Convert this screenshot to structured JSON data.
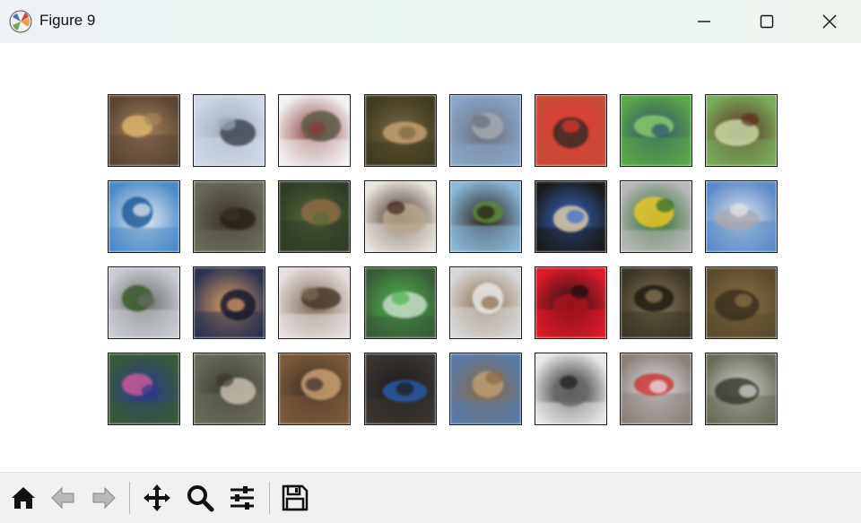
{
  "window": {
    "title": "Figure 9"
  },
  "title_bar_buttons": [
    {
      "name": "minimize",
      "icon": "minimize-icon"
    },
    {
      "name": "maximize",
      "icon": "maximize-icon"
    },
    {
      "name": "close",
      "icon": "close-icon"
    }
  ],
  "figure": {
    "rows": 4,
    "columns": 8,
    "images": [
      {
        "subject": "frog",
        "colors": [
          "#5a4636",
          "#a8845a",
          "#d9b46a"
        ]
      },
      {
        "subject": "truck",
        "colors": [
          "#cfd8e6",
          "#9aa7b8",
          "#3f4650"
        ]
      },
      {
        "subject": "truck",
        "colors": [
          "#f2f2f2",
          "#8a3a3a",
          "#5a5a4a"
        ]
      },
      {
        "subject": "deer",
        "colors": [
          "#3f3a22",
          "#7a6a42",
          "#c2a070"
        ]
      },
      {
        "subject": "automobile",
        "colors": [
          "#8aa6c8",
          "#6a6e78",
          "#a5a8b0"
        ]
      },
      {
        "subject": "automobile",
        "colors": [
          "#c84a3a",
          "#e03a2a",
          "#3a2a24"
        ]
      },
      {
        "subject": "bird",
        "colors": [
          "#5aa64a",
          "#2c4a6a",
          "#8ac86a"
        ]
      },
      {
        "subject": "horse",
        "colors": [
          "#7aaa5a",
          "#5a2e1e",
          "#c8d8a6"
        ]
      },
      {
        "subject": "ship",
        "colors": [
          "#4a8ac8",
          "#e8eef2",
          "#1e5a9a"
        ]
      },
      {
        "subject": "cat",
        "colors": [
          "#6a6a5a",
          "#3a3226",
          "#2a2018"
        ]
      },
      {
        "subject": "deer",
        "colors": [
          "#2e3a26",
          "#5a6a3a",
          "#8a6a42"
        ]
      },
      {
        "subject": "horse",
        "colors": [
          "#e8e4de",
          "#3a2418",
          "#b8a890"
        ]
      },
      {
        "subject": "horse",
        "colors": [
          "#8ab8d8",
          "#2a1a14",
          "#5a8a3a"
        ]
      },
      {
        "subject": "bird",
        "colors": [
          "#1a1a1a",
          "#3a6ac8",
          "#d8c8a6"
        ]
      },
      {
        "subject": "truck",
        "colors": [
          "#b8b8b8",
          "#2a6a2a",
          "#e8c82a"
        ]
      },
      {
        "subject": "truck",
        "colors": [
          "#5a8ac8",
          "#e8e8ec",
          "#a8a8b0"
        ]
      },
      {
        "subject": "automobile",
        "colors": [
          "#c8ccd4",
          "#6a6a64",
          "#3a5a2a"
        ]
      },
      {
        "subject": "cat",
        "colors": [
          "#2a3250",
          "#e0a068",
          "#14182a"
        ]
      },
      {
        "subject": "bird",
        "colors": [
          "#e8dede",
          "#7a6a56",
          "#4a3a2c"
        ]
      },
      {
        "subject": "frog",
        "colors": [
          "#3a5a3a",
          "#4ab84a",
          "#c8d8c8"
        ]
      },
      {
        "subject": "deer",
        "colors": [
          "#d8d8d8",
          "#8a6a4a",
          "#e8e8e8"
        ]
      },
      {
        "subject": "frog",
        "colors": [
          "#e01a2a",
          "#1a1014",
          "#a8141e"
        ]
      },
      {
        "subject": "frog",
        "colors": [
          "#3a3426",
          "#8a7a5a",
          "#1e1a12"
        ]
      },
      {
        "subject": "frog",
        "colors": [
          "#5a4a2e",
          "#8a7446",
          "#3a2e1e"
        ]
      },
      {
        "subject": "bird",
        "colors": [
          "#3a5a3a",
          "#2a3a8a",
          "#c85a9a"
        ]
      },
      {
        "subject": "frog",
        "colors": [
          "#6a6a5a",
          "#3a3a30",
          "#c8c0b0"
        ]
      },
      {
        "subject": "cat",
        "colors": [
          "#7a5a3a",
          "#3a2e26",
          "#c8a070"
        ]
      },
      {
        "subject": "dog",
        "colors": [
          "#3a3430",
          "#1a1a1a",
          "#2a5aa6"
        ]
      },
      {
        "subject": "deer",
        "colors": [
          "#5a7aa6",
          "#8a6a42",
          "#b8a070"
        ]
      },
      {
        "subject": "airplane",
        "colors": [
          "#e8e8e8",
          "#1a1a1a",
          "#6a6a6a"
        ]
      },
      {
        "subject": "airplane",
        "colors": [
          "#8a8078",
          "#e8e8f0",
          "#c83a3a"
        ]
      },
      {
        "subject": "truck",
        "colors": [
          "#6a6a58",
          "#d8d8d8",
          "#3a3a30"
        ]
      }
    ]
  },
  "toolbar": {
    "buttons": [
      {
        "name": "home",
        "icon": "home-icon"
      },
      {
        "name": "back",
        "icon": "back-arrow-icon"
      },
      {
        "name": "forward",
        "icon": "forward-arrow-icon"
      },
      {
        "name": "pan",
        "icon": "pan-icon"
      },
      {
        "name": "zoom",
        "icon": "zoom-icon"
      },
      {
        "name": "configure-subplots",
        "icon": "sliders-icon"
      },
      {
        "name": "save",
        "icon": "save-icon"
      }
    ]
  }
}
